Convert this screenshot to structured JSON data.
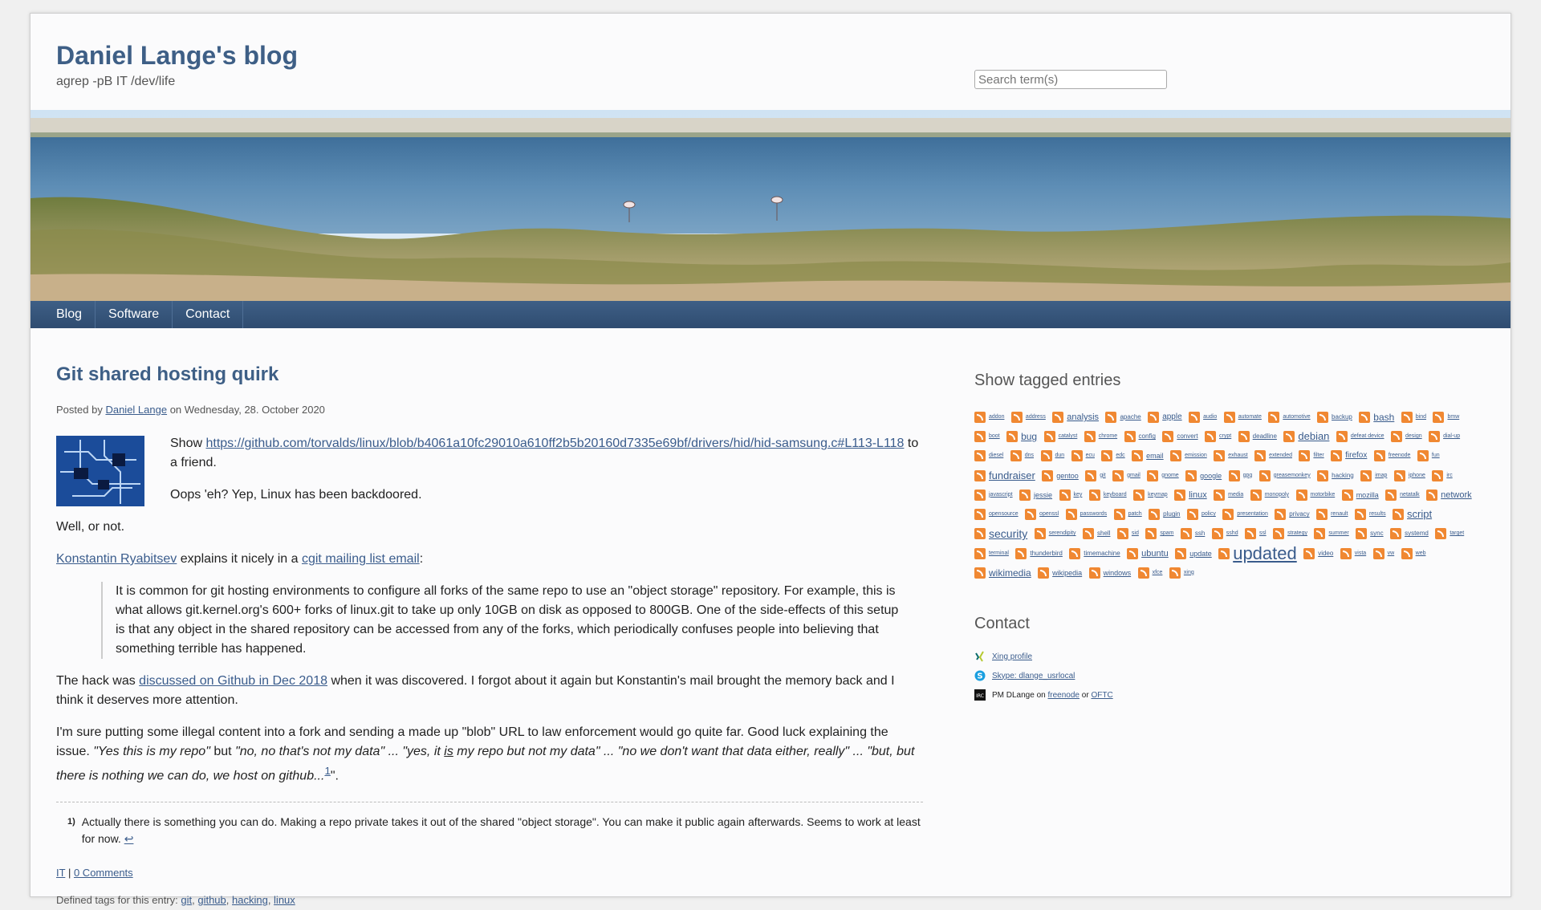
{
  "site": {
    "title": "Daniel Lange's blog",
    "tagline": "agrep -pB IT /dev/life",
    "search_placeholder": "Search term(s)"
  },
  "nav": [
    "Blog",
    "Software",
    "Contact"
  ],
  "post": {
    "title": "Git shared hosting quirk",
    "meta_prefix": "Posted by",
    "author": "Daniel Lange",
    "meta_date": "on Wednesday, 28. October 2020",
    "p1_show": "Show",
    "p1_link": "https://github.com/torvalds/linux/blob/b4061a10fc29010a610ff2b5b20160d7335e69bf/drivers/hid/hid-samsung.c#L113-L118",
    "p1_end": "to a friend.",
    "p2": "Oops 'eh? Yep, Linux has been backdoored.",
    "p3": "Well, or not.",
    "p4_person": "Konstantin Ryabitsev",
    "p4_mid": "explains it nicely in a",
    "p4_link": "cgit mailing list email",
    "p4_end": ":",
    "quote": "It is common for git hosting environments to configure all forks of the same repo to use an \"object storage\" repository. For example, this is what allows git.kernel.org's 600+ forks of linux.git to take up only 10GB on disk as opposed to 800GB. One of the side-effects of this setup is that any object in the shared repository can be accessed from any of the forks, which periodically confuses people into believing that something terrible has happened.",
    "p5_start": "The hack was",
    "p5_link": "discussed on Github in Dec 2018",
    "p5_end": "when it was discovered. I forgot about it again but Konstantin's mail brought the memory back and I think it deserves more attention.",
    "p6_start": "I'm sure putting some illegal content into a fork and sending a made up \"blob\" URL to law enforcement would go quite far. Good luck explaining the issue.",
    "p6_q1": "\"Yes this is my repo\"",
    "p6_but": "but",
    "p6_q2": "\"no, no that's not my data\" ... \"yes, it",
    "p6_is": "is",
    "p6_q3": "my repo but not my data\" ... \"no we don't want that data either, really\" ... \"but, but there is nothing we can do, we host on github...",
    "p6_sup": "1",
    "p6_end": "\".",
    "footnote_num": "1)",
    "footnote_text": "Actually there is something you can do. Making a repo private takes it out of the shared \"object storage\". You can make it public again afterwards. Seems to work at least for now.",
    "footnote_back": "↩",
    "footer_category": "IT",
    "footer_sep": "|",
    "footer_comments": "0 Comments",
    "tags_prefix": "Defined tags for this entry:",
    "tags": [
      "git",
      "github",
      "hacking",
      "linux"
    ]
  },
  "sidebar": {
    "tags_heading": "Show tagged entries",
    "tags": [
      {
        "name": "addon",
        "size": 7
      },
      {
        "name": "address",
        "size": 7
      },
      {
        "name": "analysis",
        "size": 11
      },
      {
        "name": "apache",
        "size": 8
      },
      {
        "name": "apple",
        "size": 10
      },
      {
        "name": "audio",
        "size": 7
      },
      {
        "name": "automate",
        "size": 7
      },
      {
        "name": "automotive",
        "size": 7
      },
      {
        "name": "backup",
        "size": 8
      },
      {
        "name": "bash",
        "size": 12
      },
      {
        "name": "bind",
        "size": 7
      },
      {
        "name": "bmw",
        "size": 7
      },
      {
        "name": "boot",
        "size": 7
      },
      {
        "name": "bug",
        "size": 12
      },
      {
        "name": "catalyst",
        "size": 7
      },
      {
        "name": "chrome",
        "size": 7
      },
      {
        "name": "config",
        "size": 8
      },
      {
        "name": "convert",
        "size": 8
      },
      {
        "name": "crypt",
        "size": 7
      },
      {
        "name": "deadline",
        "size": 8
      },
      {
        "name": "debian",
        "size": 13
      },
      {
        "name": "defeat device",
        "size": 7
      },
      {
        "name": "design",
        "size": 7
      },
      {
        "name": "dial-up",
        "size": 7
      },
      {
        "name": "diesel",
        "size": 7
      },
      {
        "name": "dns",
        "size": 7
      },
      {
        "name": "dun",
        "size": 7
      },
      {
        "name": "ecu",
        "size": 7
      },
      {
        "name": "edc",
        "size": 7
      },
      {
        "name": "email",
        "size": 9
      },
      {
        "name": "emission",
        "size": 7
      },
      {
        "name": "exhaust",
        "size": 7
      },
      {
        "name": "extended",
        "size": 7
      },
      {
        "name": "filter",
        "size": 7
      },
      {
        "name": "firefox",
        "size": 10
      },
      {
        "name": "freenode",
        "size": 7
      },
      {
        "name": "fun",
        "size": 7
      },
      {
        "name": "fundraiser",
        "size": 13
      },
      {
        "name": "gentoo",
        "size": 9
      },
      {
        "name": "git",
        "size": 7
      },
      {
        "name": "gmail",
        "size": 7
      },
      {
        "name": "gnome",
        "size": 7
      },
      {
        "name": "google",
        "size": 9
      },
      {
        "name": "gpg",
        "size": 7
      },
      {
        "name": "greasemonkey",
        "size": 7
      },
      {
        "name": "hacking",
        "size": 8
      },
      {
        "name": "imap",
        "size": 7
      },
      {
        "name": "iphone",
        "size": 7
      },
      {
        "name": "irc",
        "size": 7
      },
      {
        "name": "javascript",
        "size": 7
      },
      {
        "name": "jessie",
        "size": 9
      },
      {
        "name": "key",
        "size": 7
      },
      {
        "name": "keyboard",
        "size": 7
      },
      {
        "name": "keymap",
        "size": 7
      },
      {
        "name": "linux",
        "size": 11
      },
      {
        "name": "media",
        "size": 7
      },
      {
        "name": "monopoly",
        "size": 7
      },
      {
        "name": "motorbike",
        "size": 7
      },
      {
        "name": "mozilla",
        "size": 9
      },
      {
        "name": "netatalk",
        "size": 7
      },
      {
        "name": "network",
        "size": 11
      },
      {
        "name": "opensource",
        "size": 7
      },
      {
        "name": "openssl",
        "size": 7
      },
      {
        "name": "passwords",
        "size": 7
      },
      {
        "name": "patch",
        "size": 7
      },
      {
        "name": "plugin",
        "size": 8
      },
      {
        "name": "policy",
        "size": 7
      },
      {
        "name": "presentation",
        "size": 7
      },
      {
        "name": "privacy",
        "size": 8
      },
      {
        "name": "renault",
        "size": 7
      },
      {
        "name": "results",
        "size": 7
      },
      {
        "name": "script",
        "size": 13
      },
      {
        "name": "security",
        "size": 14
      },
      {
        "name": "serendipity",
        "size": 7
      },
      {
        "name": "shell",
        "size": 8
      },
      {
        "name": "sid",
        "size": 7
      },
      {
        "name": "spam",
        "size": 7
      },
      {
        "name": "ssh",
        "size": 8
      },
      {
        "name": "sshd",
        "size": 7
      },
      {
        "name": "ssl",
        "size": 7
      },
      {
        "name": "strategy",
        "size": 7
      },
      {
        "name": "summer",
        "size": 7
      },
      {
        "name": "sync",
        "size": 8
      },
      {
        "name": "systemd",
        "size": 8
      },
      {
        "name": "target",
        "size": 7
      },
      {
        "name": "terminal",
        "size": 7
      },
      {
        "name": "thunderbird",
        "size": 8
      },
      {
        "name": "timemachine",
        "size": 8
      },
      {
        "name": "ubuntu",
        "size": 11
      },
      {
        "name": "update",
        "size": 9
      },
      {
        "name": "updated",
        "size": 22
      },
      {
        "name": "video",
        "size": 8
      },
      {
        "name": "vista",
        "size": 7
      },
      {
        "name": "vw",
        "size": 7
      },
      {
        "name": "web",
        "size": 7
      },
      {
        "name": "wikimedia",
        "size": 12
      },
      {
        "name": "wikipedia",
        "size": 9
      },
      {
        "name": "windows",
        "size": 9
      },
      {
        "name": "xfce",
        "size": 7
      },
      {
        "name": "xing",
        "size": 7
      }
    ],
    "contact_heading": "Contact",
    "contacts": {
      "xing": "Xing profile",
      "skype": "Skype: dlange_usrlocal",
      "irc_prefix": "PM DLange on",
      "irc_net1": "freenode",
      "irc_or": "or",
      "irc_net2": "OFTC"
    }
  }
}
